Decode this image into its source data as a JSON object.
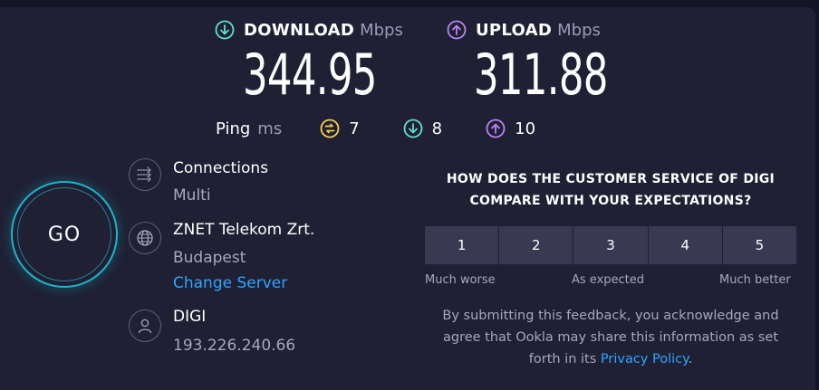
{
  "download": {
    "label": "DOWNLOAD",
    "unit": "Mbps",
    "value": "344.95",
    "icon": "download-arrow-icon",
    "color": "#5ee0d3"
  },
  "upload": {
    "label": "UPLOAD",
    "unit": "Mbps",
    "value": "311.88",
    "icon": "upload-arrow-icon",
    "color": "#b985f4"
  },
  "ping": {
    "label": "Ping",
    "unit": "ms",
    "idle": "7",
    "download": "8",
    "upload": "10",
    "idle_color": "#f6d24a"
  },
  "go_label": "GO",
  "connections": {
    "title": "Connections",
    "value": "Multi"
  },
  "server": {
    "name": "ZNET Telekom Zrt.",
    "location": "Budapest",
    "change_link": "Change Server"
  },
  "provider": {
    "name": "DIGI",
    "ip": "193.226.240.66"
  },
  "survey": {
    "question_line1": "HOW DOES THE CUSTOMER SERVICE OF DIGI",
    "question_line2": "COMPARE WITH YOUR EXPECTATIONS?",
    "options": [
      "1",
      "2",
      "3",
      "4",
      "5"
    ],
    "label_low": "Much worse",
    "label_mid": "As expected",
    "label_high": "Much better",
    "disclaimer_line1": "By submitting this feedback, you acknowledge and",
    "disclaimer_line2": "agree that Ookla may share this information as set",
    "disclaimer_prefix": "forth in its ",
    "privacy_link": "Privacy Policy",
    "disclaimer_suffix": "."
  }
}
